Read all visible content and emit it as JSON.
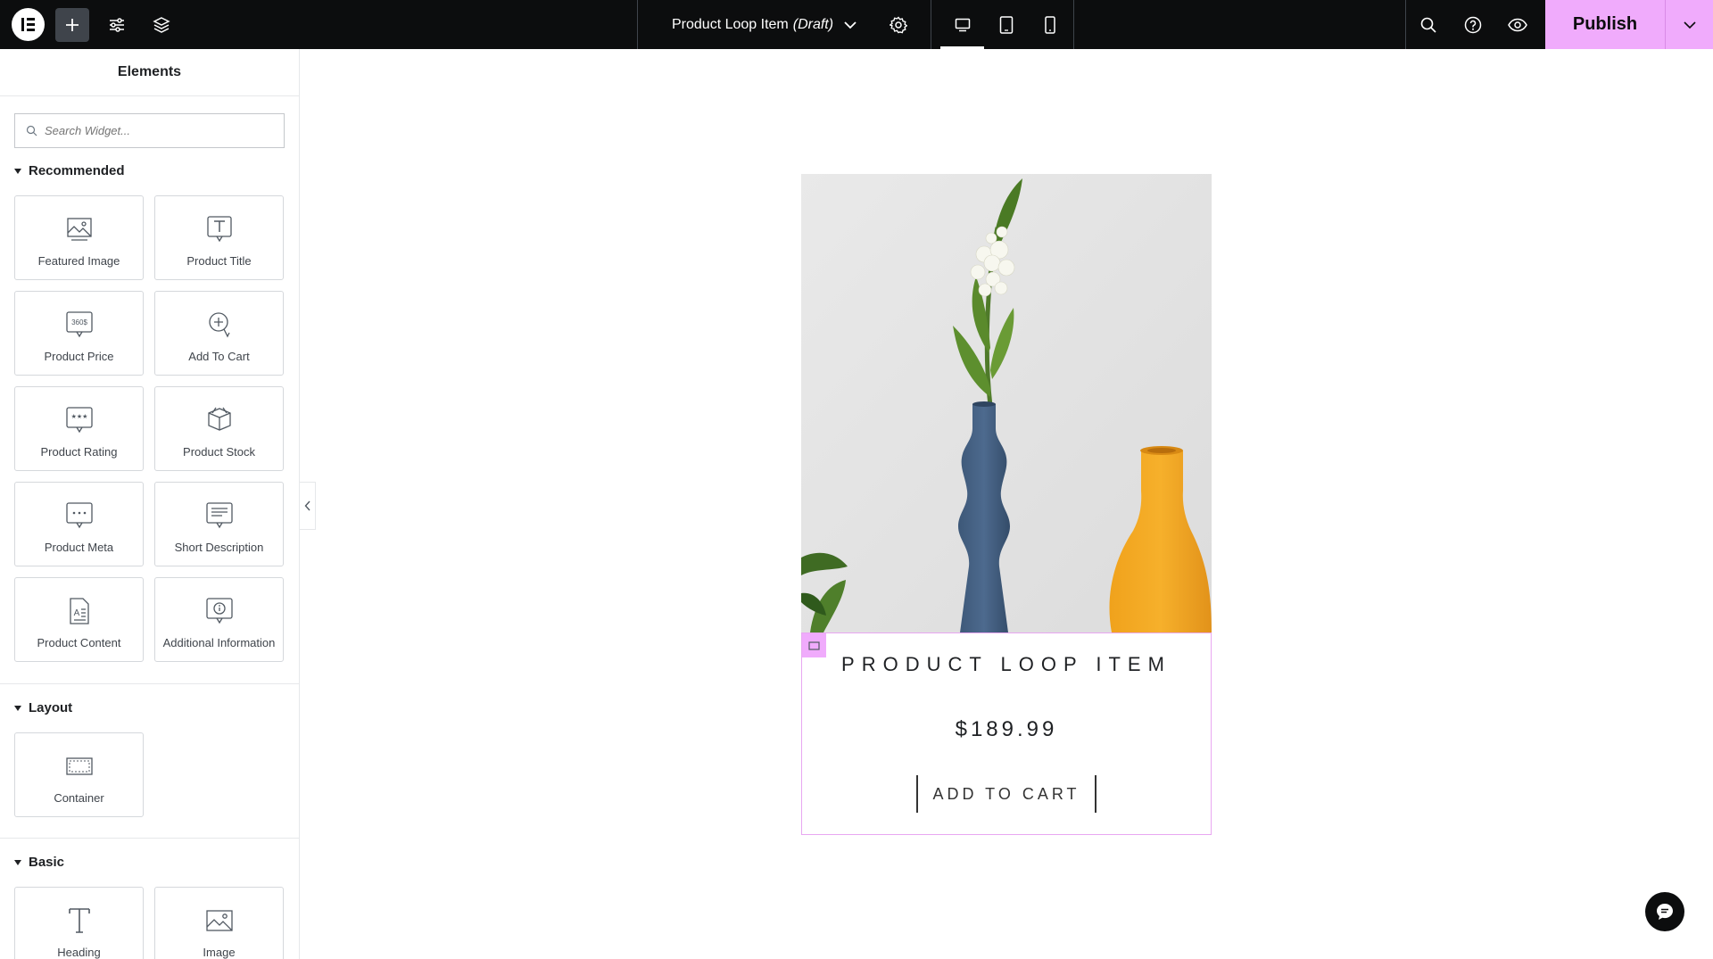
{
  "topbar": {
    "document_title": "Product Loop Item",
    "document_status": "(Draft)",
    "publish_label": "Publish",
    "icons": [
      "elementor-logo-icon",
      "plus-icon",
      "sliders-icon",
      "layers-icon",
      "chevron-down-icon",
      "gear-icon",
      "desktop-icon",
      "tablet-icon",
      "mobile-icon",
      "search-icon",
      "help-icon",
      "eye-icon",
      "chevron-down-icon"
    ],
    "accent_color": "#f0abfc"
  },
  "panel": {
    "title": "Elements",
    "search_placeholder": "Search Widget...",
    "sections": {
      "recommended": {
        "title": "Recommended",
        "widgets": [
          {
            "label": "Featured Image",
            "icon": "featured-image-icon"
          },
          {
            "label": "Product Title",
            "icon": "product-title-icon"
          },
          {
            "label": "Product Price",
            "icon": "product-price-icon"
          },
          {
            "label": "Add To Cart",
            "icon": "add-to-cart-icon"
          },
          {
            "label": "Product Rating",
            "icon": "product-rating-icon"
          },
          {
            "label": "Product Stock",
            "icon": "product-stock-icon"
          },
          {
            "label": "Product Meta",
            "icon": "product-meta-icon"
          },
          {
            "label": "Short Description",
            "icon": "short-description-icon"
          },
          {
            "label": "Product Content",
            "icon": "product-content-icon"
          },
          {
            "label": "Additional Information",
            "icon": "additional-information-icon"
          }
        ]
      },
      "layout": {
        "title": "Layout",
        "widgets": [
          {
            "label": "Container",
            "icon": "container-icon"
          }
        ]
      },
      "basic": {
        "title": "Basic",
        "widgets": [
          {
            "label": "Heading",
            "icon": "heading-icon"
          },
          {
            "label": "Image",
            "icon": "image-icon"
          }
        ]
      }
    }
  },
  "canvas": {
    "product": {
      "title": "PRODUCT LOOP ITEM",
      "price": "$189.99",
      "cart_label": "ADD TO CART",
      "image_alt": "vases-photo"
    }
  }
}
